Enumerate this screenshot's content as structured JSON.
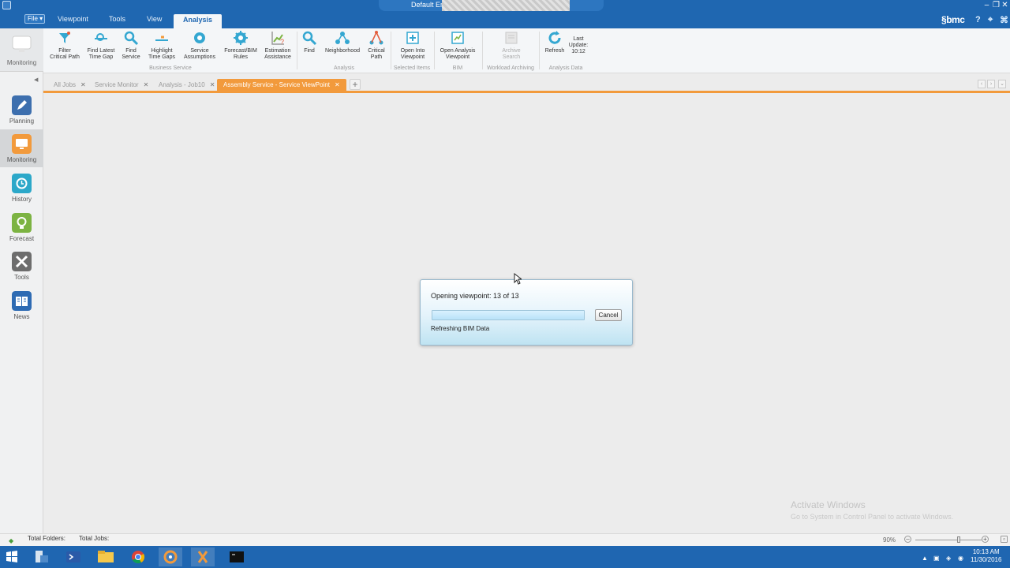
{
  "window": {
    "title": "Default Er"
  },
  "menu": {
    "file_label": "File ▾",
    "tabs": [
      {
        "label": "Viewpoint"
      },
      {
        "label": "Tools"
      },
      {
        "label": "View"
      },
      {
        "label": "Analysis"
      }
    ],
    "brand": "bmc",
    "help_icon_glyph": "?",
    "pin_icon_glyph": "⌖"
  },
  "sidebar": {
    "top_label": "Monitoring",
    "items": [
      {
        "label": "Planning",
        "icon": "pencil-icon",
        "color": "#3d6fae"
      },
      {
        "label": "Monitoring",
        "icon": "monitor-icon",
        "color": "#f29a3c"
      },
      {
        "label": "History",
        "icon": "history-icon",
        "color": "#2ca8c9"
      },
      {
        "label": "Forecast",
        "icon": "forecast-icon",
        "color": "#7cb342"
      },
      {
        "label": "Tools",
        "icon": "tools-icon",
        "color": "#6d6d6d"
      },
      {
        "label": "News",
        "icon": "news-icon",
        "color": "#2e6bb3"
      }
    ]
  },
  "ribbon": {
    "buttons": [
      {
        "label": "Filter\nCritical Path",
        "icon": "filter-critical-path-icon"
      },
      {
        "label": "Find Latest\nTime Gap",
        "icon": "find-latest-time-gap-icon"
      },
      {
        "label": "Find\nService",
        "icon": "find-service-icon"
      },
      {
        "label": "Highlight\nTime Gaps",
        "icon": "highlight-time-gaps-icon"
      },
      {
        "label": "Service\nAssumptions",
        "icon": "service-assumptions-icon"
      },
      {
        "label": "Forecast/BIM\nRules",
        "icon": "forecast-bim-rules-icon"
      },
      {
        "label": "Estimation\nAssistance",
        "icon": "estimation-assistance-icon"
      },
      {
        "label": "Find",
        "icon": "find-icon"
      },
      {
        "label": "Neighborhood",
        "icon": "neighborhood-icon"
      },
      {
        "label": "Critical\nPath",
        "icon": "critical-path-icon"
      },
      {
        "label": "Open Into\nViewpoint",
        "icon": "open-into-viewpoint-icon"
      },
      {
        "label": "Open Analysis\nViewpoint",
        "icon": "open-analysis-viewpoint-icon"
      },
      {
        "label": "Archive\nSearch",
        "icon": "archive-search-icon"
      },
      {
        "label": "Refresh",
        "icon": "refresh-icon"
      },
      {
        "label": "Last\nUpdate:\n10:12",
        "icon": "last-update-icon"
      }
    ],
    "groups": [
      {
        "label": "Business Service"
      },
      {
        "label": "Analysis"
      },
      {
        "label": "Selected Items"
      },
      {
        "label": "BIM"
      },
      {
        "label": "Workload Archiving"
      },
      {
        "label": "Analysis Data"
      }
    ]
  },
  "tabs": [
    {
      "label": "All Jobs"
    },
    {
      "label": "Service Monitor"
    },
    {
      "label": "Analysis - Job10"
    },
    {
      "label": "Assembly Service - Service ViewPoint"
    }
  ],
  "dialog": {
    "message": "Opening viewpoint: 13 of 13",
    "progress": 1.0,
    "cancel_label": "Cancel",
    "status": "Refreshing BIM Data"
  },
  "watermark": {
    "title": "Activate Windows",
    "subtitle": "Go to System in Control Panel to activate Windows."
  },
  "statusbar": {
    "folders_label": "Total Folders:",
    "jobs_label": "Total Jobs:",
    "zoom": "90%",
    "zoom_level": 0.65
  },
  "taskbar": {
    "time": "10:13 AM",
    "date": "11/30/2016",
    "apps": [
      {
        "icon": "windows-start-icon"
      },
      {
        "icon": "server-manager-icon"
      },
      {
        "icon": "powershell-icon"
      },
      {
        "icon": "file-explorer-icon"
      },
      {
        "icon": "chrome-icon"
      },
      {
        "icon": "control-m-icon"
      },
      {
        "icon": "control-m-config-icon"
      },
      {
        "icon": "command-prompt-icon"
      }
    ]
  }
}
